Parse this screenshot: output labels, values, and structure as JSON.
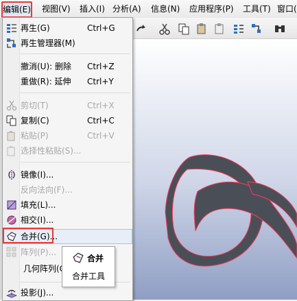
{
  "menubar": {
    "items": [
      "编辑(E)",
      "视图(V)",
      "插入(I)",
      "分析(A)",
      "信息(N)",
      "应用程序(P)",
      "工具(T)",
      "窗口("
    ]
  },
  "toolbar": {
    "icons": [
      "redo-arrow-icon",
      "cut-icon",
      "copy-icon",
      "paste-icon",
      "paste-special-icon",
      "regenerate-icon",
      "regen-manager-icon",
      "find-icon"
    ]
  },
  "edit_menu": {
    "items": [
      {
        "label": "再生(G)",
        "shortcut": "Ctrl+G",
        "icon": "regenerate-icon",
        "disabled": false
      },
      {
        "label": "再生管理器(M)",
        "shortcut": "",
        "icon": "regen-manager-icon",
        "disabled": false
      },
      {
        "label": "撤消(U): 删除",
        "shortcut": "Ctrl+Z",
        "icon": "",
        "disabled": false
      },
      {
        "label": "重做(R): 延伸",
        "shortcut": "Ctrl+Y",
        "icon": "",
        "disabled": false
      },
      {
        "label": "剪切(T)",
        "shortcut": "Ctrl+X",
        "icon": "cut-icon",
        "disabled": true
      },
      {
        "label": "复制(C)",
        "shortcut": "Ctrl+C",
        "icon": "copy-icon",
        "disabled": false
      },
      {
        "label": "粘贴(P)",
        "shortcut": "Ctrl+V",
        "icon": "paste-icon",
        "disabled": true
      },
      {
        "label": "选择性粘贴(S)...",
        "shortcut": "",
        "icon": "paste-special-icon",
        "disabled": true
      },
      {
        "label": "镜像(I)...",
        "shortcut": "",
        "icon": "mirror-icon",
        "disabled": false
      },
      {
        "label": "反向法向(F)...",
        "shortcut": "",
        "icon": "",
        "disabled": true
      },
      {
        "label": "填充(L)...",
        "shortcut": "",
        "icon": "fill-icon",
        "disabled": false
      },
      {
        "label": "相交(I)...",
        "shortcut": "",
        "icon": "intersect-icon",
        "disabled": false
      },
      {
        "label": "合并(G)...",
        "shortcut": "",
        "icon": "merge-icon",
        "disabled": false
      },
      {
        "label": "阵列(P)...",
        "shortcut": "",
        "icon": "pattern-icon",
        "disabled": true
      },
      {
        "label": "几何阵列(G",
        "shortcut": "",
        "icon": "",
        "disabled": false
      },
      {
        "label": "投影(J)...",
        "shortcut": "",
        "icon": "project-icon",
        "disabled": false
      }
    ]
  },
  "tooltip": {
    "title": "合并",
    "description": "合并工具",
    "icon": "merge-icon"
  },
  "colors": {
    "highlight_border": "#e53935",
    "shape_fill": "#4a4f57",
    "shape_edge": "#ff3b5c"
  }
}
